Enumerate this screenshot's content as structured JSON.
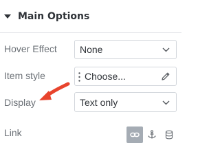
{
  "section": {
    "title": "Main Options"
  },
  "fields": {
    "hover_effect": {
      "label": "Hover Effect",
      "value": "None"
    },
    "item_style": {
      "label": "Item style",
      "value": "Choose..."
    },
    "display": {
      "label": "Display",
      "value": "Text only"
    },
    "link": {
      "label": "Link"
    }
  },
  "link_options": [
    {
      "icon": "link-icon",
      "active": true
    },
    {
      "icon": "anchor-icon",
      "active": false
    },
    {
      "icon": "database-icon",
      "active": false
    }
  ],
  "colors": {
    "annotation_arrow": "#e8442d",
    "active_toggle": "#a5acb4",
    "text": "#2f3338",
    "label": "#6b7076"
  }
}
